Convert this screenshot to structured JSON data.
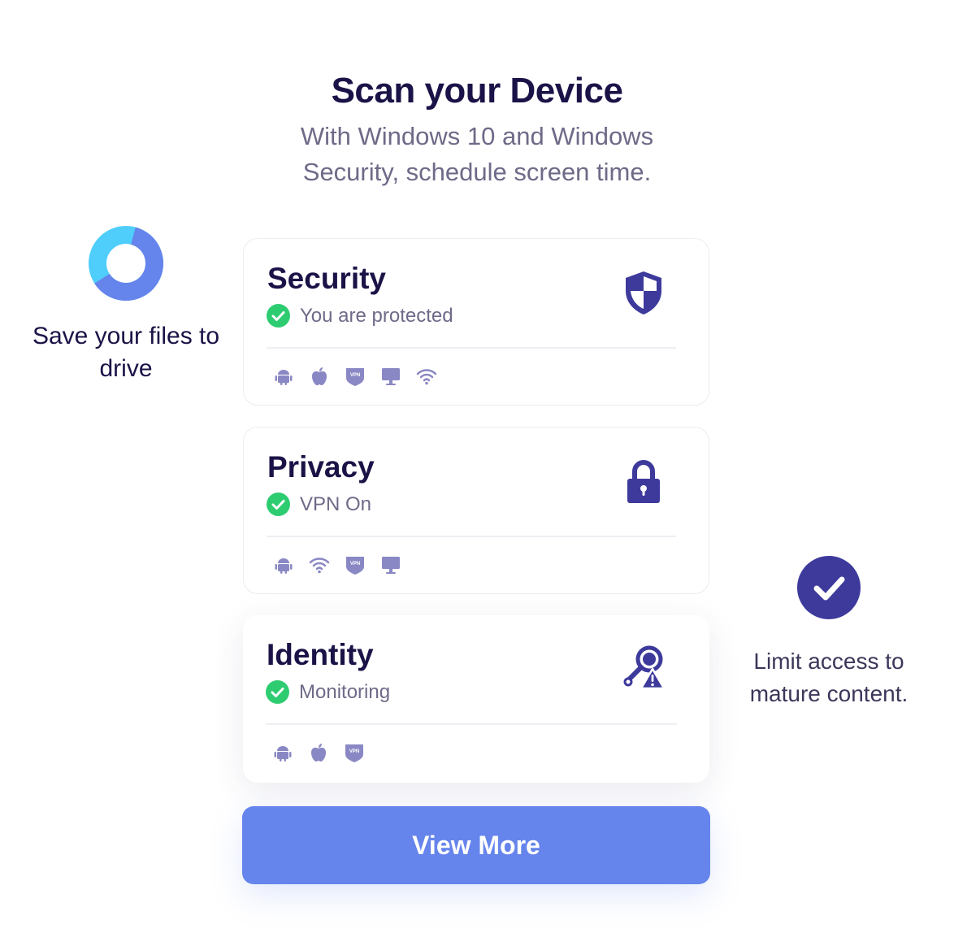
{
  "header": {
    "title": "Scan your Device",
    "subtitle": "With Windows 10 and Windows Security, schedule screen time."
  },
  "left_feature": {
    "icon": "donut-chart-icon",
    "caption": "Save your files to drive"
  },
  "right_feature": {
    "icon": "check-circle-icon",
    "caption": "Limit access to mature content."
  },
  "cards": [
    {
      "title": "Security",
      "status": "You are protected",
      "icon": "shield-icon",
      "platforms": [
        "android-icon",
        "apple-icon",
        "vpn-icon",
        "monitor-icon",
        "wifi-icon"
      ]
    },
    {
      "title": "Privacy",
      "status": "VPN On",
      "icon": "lock-icon",
      "platforms": [
        "android-icon",
        "wifi-icon",
        "vpn-icon",
        "monitor-icon"
      ]
    },
    {
      "title": "Identity",
      "status": "Monitoring",
      "icon": "identity-search-icon",
      "platforms": [
        "android-icon",
        "apple-icon",
        "vpn-icon"
      ]
    }
  ],
  "view_more_label": "View More",
  "colors": {
    "heading": "#1a1347",
    "muted": "#6e6a88",
    "accent": "#3d3a9c",
    "success": "#2ecc71",
    "button": "#6584ec",
    "platform_icon": "#8a88c4",
    "donut_light": "#4fcdfb",
    "donut_dark": "#6584ec"
  }
}
